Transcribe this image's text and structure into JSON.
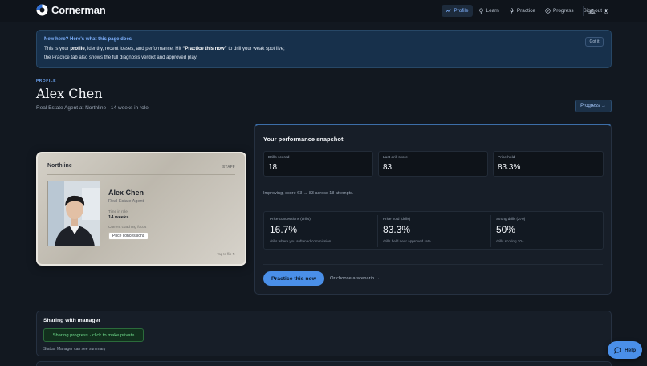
{
  "nav": {
    "brand": "Cornerman",
    "items": [
      {
        "label": "Profile",
        "icon": "trend-icon",
        "active": true
      },
      {
        "label": "Learn",
        "icon": "bulb-icon",
        "active": false
      },
      {
        "label": "Practice",
        "icon": "mic-icon",
        "active": false
      },
      {
        "label": "Progress",
        "icon": "check-circle-icon",
        "active": false
      }
    ],
    "signout": "Sign out"
  },
  "banner": {
    "title": "New here? Here's what this page does",
    "text_1": "This is your ",
    "bold_1": "profile",
    "text_2": ", identity, recent losses, and performance. Hit ",
    "bold_2": "“Practice this now”",
    "text_3": " to drill your weak spot live; the Practice tab also shows the full diagnosis verdict and approved play.",
    "dismiss": "Got it"
  },
  "profile": {
    "eyebrow": "PROFILE",
    "name": "Alex Chen",
    "role_line": "Real Estate Agent at Northline · 14 weeks in role",
    "progress_button": "Progress →"
  },
  "idcard": {
    "org": "Northline",
    "badge": "STAFF",
    "name": "Alex Chen",
    "role": "Real Estate Agent",
    "time_label": "Time in role",
    "time_value": "14 weeks",
    "focus_label": "Current coaching focus",
    "focus_value": "Price concessions",
    "flip_hint": "Tap to flip ↻"
  },
  "snapshot": {
    "title": "Your performance snapshot",
    "stats": [
      {
        "label": "Drills scored",
        "value": "18"
      },
      {
        "label": "Last drill score",
        "value": "83"
      },
      {
        "label": "Price hold",
        "value": "83.3%"
      }
    ],
    "trend": "Improving, score 63 → 83 across 18 attempts.",
    "metrics": [
      {
        "label": "Price concessions (drills)",
        "value": "16.7%",
        "sub": "drills where you softened commission"
      },
      {
        "label": "Price hold (drills)",
        "value": "83.3%",
        "sub": "drills held near approved rate"
      },
      {
        "label": "Strong drills (≥70)",
        "value": "50%",
        "sub": "drills scoring 70+"
      }
    ],
    "practice_button": "Practice this now",
    "scenario_link": "Or choose a scenario →"
  },
  "sharing": {
    "title": "Sharing with manager",
    "toggle_label": "Sharing progress · click to make private",
    "status": "Status: Manager can see summary"
  },
  "help": {
    "label": "Help"
  },
  "colors": {
    "accent": "#4a8fe8",
    "background": "#121820",
    "success": "#6fdc8c"
  }
}
